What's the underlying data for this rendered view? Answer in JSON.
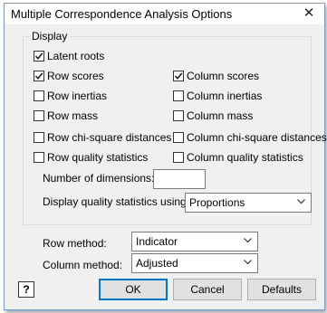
{
  "window": {
    "title": "Multiple Correspondence Analysis Options"
  },
  "display": {
    "group_title": "Display",
    "latent_roots": {
      "label": "Latent roots",
      "checked": true
    },
    "row_scores": {
      "label": "Row scores",
      "checked": true
    },
    "column_scores": {
      "label": "Column scores",
      "checked": true
    },
    "row_inertias": {
      "label": "Row inertias",
      "checked": false
    },
    "column_inertias": {
      "label": "Column inertias",
      "checked": false
    },
    "row_mass": {
      "label": "Row mass",
      "checked": false
    },
    "column_mass": {
      "label": "Column mass",
      "checked": false
    },
    "row_chi": {
      "label": "Row chi-square distances",
      "checked": false
    },
    "column_chi": {
      "label": "Column chi-square distances",
      "checked": false
    },
    "row_quality": {
      "label": "Row quality statistics",
      "checked": false
    },
    "column_quality": {
      "label": "Column quality statistics",
      "checked": false
    },
    "dimensions_label": "Number of dimensions:",
    "dimensions_value": "",
    "quality_using_label": "Display quality statistics using:",
    "quality_using_value": "Proportions"
  },
  "row_method": {
    "label": "Row method:",
    "value": "Indicator"
  },
  "column_method": {
    "label": "Column method:",
    "value": "Adjusted"
  },
  "buttons": {
    "help": "?",
    "ok": "OK",
    "cancel": "Cancel",
    "defaults": "Defaults"
  }
}
